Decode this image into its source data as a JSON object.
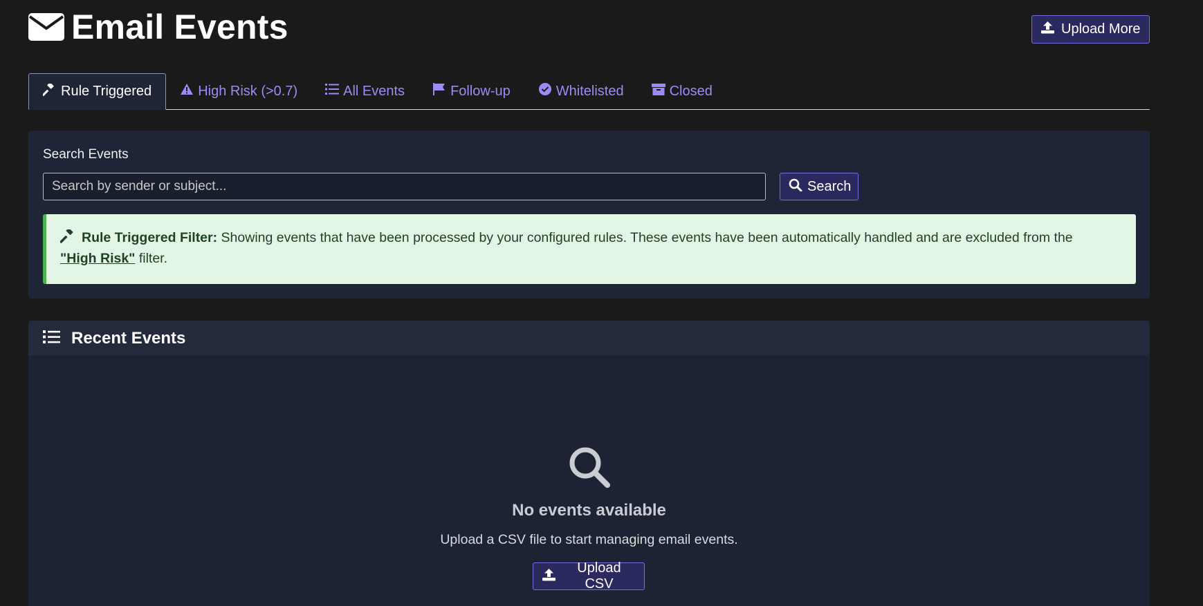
{
  "header": {
    "title": "Email Events",
    "upload_more_label": "Upload More"
  },
  "tabs": [
    {
      "label": "Rule Triggered",
      "icon": "gavel-icon",
      "active": true
    },
    {
      "label": "High Risk (>0.7)",
      "icon": "warning-icon",
      "active": false
    },
    {
      "label": "All Events",
      "icon": "list-icon",
      "active": false
    },
    {
      "label": "Follow-up",
      "icon": "flag-icon",
      "active": false
    },
    {
      "label": "Whitelisted",
      "icon": "check-circle-icon",
      "active": false
    },
    {
      "label": "Closed",
      "icon": "archive-icon",
      "active": false
    }
  ],
  "search": {
    "label": "Search Events",
    "placeholder": "Search by sender or subject...",
    "value": "",
    "button_label": "Search"
  },
  "alert": {
    "title": "Rule Triggered Filter:",
    "text": " Showing events that have been processed by your configured rules. These events have been automatically handled and are excluded from the",
    "link": "\"High Risk\"",
    "suffix": " filter."
  },
  "recent": {
    "title": "Recent Events",
    "empty_title": "No events available",
    "empty_text": "Upload a CSV file to start managing email events.",
    "upload_label": "Upload CSV"
  },
  "colors": {
    "background": "#1a1a1b",
    "panel": "#1e2536",
    "accent": "#9b8cf5",
    "button": "#2b2a5e",
    "alert_bg": "#e3f6e6",
    "alert_border": "#4caf50"
  }
}
